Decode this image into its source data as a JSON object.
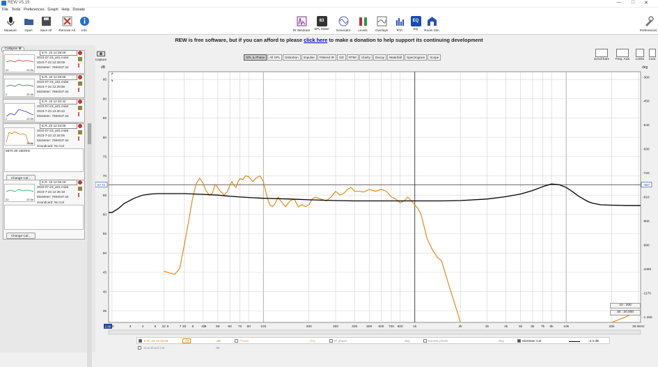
{
  "window": {
    "title": "REW V5.19",
    "minimize": "—",
    "maximize": "□",
    "close": "✕"
  },
  "menu": [
    "File",
    "Tools",
    "Preferences",
    "Graph",
    "Help",
    "Donate"
  ],
  "toolbar_left": [
    {
      "label": "Measure",
      "icon": "microphone-icon",
      "color": "#2a2a2a"
    },
    {
      "label": "Open",
      "icon": "folder-icon",
      "color": "#3a5d9a"
    },
    {
      "label": "Save All",
      "icon": "save-icon",
      "color": "#4a4a4a"
    },
    {
      "label": "Remove All",
      "icon": "remove-all-icon",
      "color": "#c0392b"
    },
    {
      "label": "Info",
      "icon": "info-icon",
      "color": "#1f6fd0"
    }
  ],
  "toolbar_center": [
    {
      "label": "IR Windows",
      "icon": "ir-windows-icon",
      "color": "#7a3a8a"
    },
    {
      "label": "SPL Meter",
      "icon": "spl-meter-icon",
      "color": "#333333",
      "text": "83"
    },
    {
      "label": "Generator",
      "icon": "generator-icon",
      "color": "#5060c0"
    },
    {
      "label": "Levels",
      "icon": "levels-icon",
      "color": "#c03030"
    },
    {
      "label": "Overlays",
      "icon": "overlays-icon",
      "color": "#6a6a6a"
    },
    {
      "label": "RTA",
      "icon": "rta-icon",
      "color": "#2a50b0"
    },
    {
      "label": "EQ",
      "icon": "eq-icon",
      "color": "#1a4ab0",
      "text": "EQ"
    },
    {
      "label": "Room Sim",
      "icon": "room-sim-icon",
      "color": "#2a50b0"
    }
  ],
  "toolbar_right": {
    "label": "Preferences",
    "icon": "preferences-icon"
  },
  "banner": {
    "before": "REW is free software, but if you can afford to please ",
    "link": "click here",
    "after": " to make a donation to help support its continuing development"
  },
  "left_panel": {
    "collapse_label": "Collapse",
    "measurements": [
      {
        "name": "E.R. 23 12:28:09",
        "file": "2023-07-23_a01.mdat",
        "date": "2023-7-23 12:28:09",
        "cal": "MicMeter: 7694037.txt",
        "thumb_color": "#c03030",
        "axis_left": "22",
        "axis_right": "20.0k"
      },
      {
        "name": "E.R. 23 12:29:56",
        "file": "2023-07-23_a01.mdat",
        "date": "2023-7-23 12:29:56",
        "cal": "MicMeter: 7694037.txt",
        "thumb_color": "#2a6a3a",
        "axis_left": "2",
        "axis_right": "20.0k"
      },
      {
        "name": "E.R. 23 12:30:42",
        "file": "2023-07-23_a01.mdat",
        "date": "2023-7-23 12:30:42",
        "cal": "MicMeter: 7694037.txt",
        "thumb_color": "#2a40c0",
        "axis_left": "2",
        "axis_right": "20.0k"
      },
      {
        "name": "E.R. 23 12:34:06",
        "file": "2023-07-23_a01.mdat",
        "date": "2023-7-23 12:34:06",
        "cal": "MicMeter: 7694037.txt",
        "extra": "Soundcard: No Cal",
        "thumb_color": "#e07a10",
        "axis_left": "",
        "axis_right": "20.0k"
      },
      {
        "name": "E.R. 23 12:36:18",
        "file": "2023-07-23_a01.mdat",
        "date": "2023-7-23 12:36:18",
        "cal": "MicMeter: 7694037.txt",
        "extra": "Soundcard: No Cal",
        "thumb_color": "#1a9a3a",
        "axis_left": "22",
        "axis_right": "20.0k"
      }
    ],
    "notes_text": "6870 30-1600Hz",
    "change_cal": "Change Cal..."
  },
  "graph_tabs": [
    "SPL & Phase",
    "All SPL",
    "Distortion",
    "Impulse",
    "Filtered IR",
    "GD",
    "RT60",
    "Clarity",
    "Decay",
    "Waterfall",
    "Spectrogram",
    "Scope"
  ],
  "active_tab": "SPL & Phase",
  "left_tools": {
    "capture": "Capture",
    "unit": "dB"
  },
  "right_tools": [
    {
      "label": "Scroll bars",
      "icon": "scroll-bars-icon"
    },
    {
      "label": "Freq. Axis",
      "icon": "freq-axis-icon"
    },
    {
      "label": "Limits",
      "icon": "limits-icon"
    },
    {
      "label": "Cont",
      "icon": "controls-icon"
    }
  ],
  "right_unit": "deg",
  "chart_data": {
    "type": "line",
    "xscale": "log",
    "xlim": [
      9.5,
      31000
    ],
    "ylim": [
      32,
      97
    ],
    "y2lim": [
      -1280,
      -340
    ],
    "grid": true,
    "x_ticks": [
      {
        "v": 10,
        "label": "10"
      },
      {
        "v": 22,
        "label": "22"
      },
      {
        "v": 30,
        "label": "30"
      },
      {
        "v": 40,
        "label": "40"
      },
      {
        "v": 50,
        "label": "50"
      },
      {
        "v": 60,
        "label": "60"
      },
      {
        "v": 70,
        "label": "70"
      },
      {
        "v": 80,
        "label": "80"
      },
      {
        "v": 100,
        "label": "100"
      },
      {
        "v": 200,
        "label": "200"
      },
      {
        "v": 300,
        "label": "300"
      },
      {
        "v": 400,
        "label": "400"
      },
      {
        "v": 500,
        "label": "500"
      },
      {
        "v": 600,
        "label": "600"
      },
      {
        "v": 700,
        "label": "700"
      },
      {
        "v": 800,
        "label": "800"
      },
      {
        "v": 1000,
        "label": "1k"
      },
      {
        "v": 2000,
        "label": "2k"
      },
      {
        "v": 3000,
        "label": "3k"
      },
      {
        "v": 4000,
        "label": "4k"
      },
      {
        "v": 5000,
        "label": "5k"
      },
      {
        "v": 6000,
        "label": "6k"
      },
      {
        "v": 7000,
        "label": "7k"
      },
      {
        "v": 8000,
        "label": "8k"
      },
      {
        "v": 10000,
        "label": "10k"
      },
      {
        "v": 20000,
        "label": "20k"
      },
      {
        "v": 30000,
        "label": "30.0kHz"
      }
    ],
    "x_ticks_left": [
      {
        "v": 3,
        "label": "3"
      },
      {
        "v": 4,
        "label": "4"
      },
      {
        "v": 5,
        "label": "5"
      },
      {
        "v": 6,
        "label": "6"
      },
      {
        "v": 7,
        "label": "7"
      },
      {
        "v": 8,
        "label": "8"
      },
      {
        "v": 9,
        "label": "9"
      }
    ],
    "x_start_label": "2.00",
    "y_ticks": [
      95,
      90,
      85,
      80,
      75,
      70,
      65,
      60,
      55,
      50,
      45,
      40,
      35
    ],
    "y2_ticks": [
      {
        "v": -360,
        "label": "-360"
      },
      {
        "v": -450,
        "label": "-450"
      },
      {
        "v": -540,
        "label": "-540"
      },
      {
        "v": -630,
        "label": "-630"
      },
      {
        "v": -720,
        "label": "-720"
      },
      {
        "v": -810,
        "label": "-810"
      },
      {
        "v": -900,
        "label": "-900"
      },
      {
        "v": -990,
        "label": "-990"
      },
      {
        "v": -1080,
        "label": "-1080"
      },
      {
        "v": -1170,
        "label": "-1170"
      },
      {
        "v": -1260,
        "label": "-1 260"
      }
    ],
    "y_cursor": {
      "value": 67.7,
      "label": "67.72"
    },
    "y2_cursor_label": "-567",
    "x_cursor": 1000,
    "series": [
      {
        "name": "E.R. 23 12:34:06",
        "color": "#e08a1a",
        "x": [
          22,
          24,
          26,
          28,
          30,
          32,
          34,
          36,
          38,
          40,
          42,
          44,
          46,
          48,
          50,
          52,
          55,
          58,
          60,
          62,
          64,
          66,
          68,
          70,
          73,
          76,
          80,
          85,
          90,
          95,
          100,
          105,
          110,
          115,
          120,
          125,
          130,
          140,
          150,
          160,
          170,
          180,
          190,
          200,
          210,
          220,
          240,
          260,
          280,
          300,
          320,
          340,
          360,
          380,
          400,
          430,
          460,
          500,
          550,
          600,
          650,
          700,
          750,
          800,
          850,
          900,
          950,
          1000,
          1050,
          1100,
          1150,
          1200,
          1300,
          1400,
          1500,
          1700,
          1900,
          2000,
          2200,
          2400,
          2600,
          3000,
          3500,
          4000,
          5000,
          6000,
          7000,
          8000,
          10000,
          12000,
          15000,
          20000,
          25000,
          30000
        ],
        "values": [
          45.3,
          44.8,
          44.5,
          46.0,
          52.0,
          58.0,
          64.0,
          68.0,
          69.4,
          68.0,
          66.0,
          65.0,
          65.5,
          67.8,
          67.0,
          66.0,
          65.0,
          66.0,
          67.5,
          68.5,
          67.5,
          67.0,
          68.5,
          69.3,
          69.0,
          70.0,
          69.8,
          68.5,
          69.5,
          70.0,
          68.5,
          65.0,
          62.5,
          62.0,
          63.0,
          64.5,
          63.5,
          62.0,
          63.5,
          64.0,
          62.0,
          62.5,
          62.0,
          62.5,
          64.0,
          64.5,
          64.0,
          63.5,
          64.5,
          66.0,
          65.0,
          65.5,
          66.5,
          67.0,
          66.0,
          66.0,
          65.8,
          66.5,
          66.0,
          66.5,
          66.0,
          64.5,
          64.0,
          63.0,
          63.5,
          64.5,
          63.5,
          62.5,
          61.5,
          60.0,
          57.0,
          54.0,
          51.0,
          49.0,
          48.0,
          41.0,
          35.0,
          32.0,
          28.0,
          25.0,
          22.0,
          19.0,
          19.0,
          19.0,
          21.0,
          22.0,
          24.0,
          25.0,
          27.0,
          29.0,
          30.0,
          32.0,
          33.5,
          35.0
        ]
      },
      {
        "name": "MicMeter Cal",
        "color": "#000000",
        "x": [
          9.5,
          10,
          11,
          12,
          14,
          16,
          18,
          20,
          22,
          25,
          30,
          35,
          40,
          50,
          60,
          80,
          100,
          150,
          200,
          300,
          400,
          500,
          700,
          1000,
          1500,
          2000,
          3000,
          4000,
          5000,
          6000,
          7000,
          8000,
          9000,
          10000,
          11000,
          12000,
          13000,
          14000,
          15000,
          17000,
          20000,
          25000,
          31000
        ],
        "values": [
          60.5,
          60.5,
          61.5,
          62.8,
          64.2,
          65.0,
          65.3,
          65.4,
          65.4,
          65.4,
          65.4,
          65.3,
          65.2,
          65.0,
          64.7,
          64.4,
          64.2,
          64.0,
          63.8,
          63.6,
          63.5,
          63.5,
          63.5,
          63.5,
          63.5,
          63.6,
          64.0,
          64.6,
          65.3,
          66.2,
          67.2,
          67.9,
          67.7,
          67.0,
          65.9,
          64.8,
          64.0,
          63.3,
          62.9,
          62.5,
          62.4,
          62.3,
          62.3
        ]
      }
    ]
  },
  "right_range": {
    "top": "10 : 200",
    "bottom": "30 : 20,000"
  },
  "legend": {
    "row1": {
      "meas_label": "E.R. 23 12:34:06",
      "smoothing": "1/6",
      "unit_spl": "dB",
      "phase": "Phase",
      "deg1": "deg",
      "ir_phase": "IR phase",
      "deg2": "deg",
      "excess": "Excess phase",
      "deg3": "deg",
      "cal": "MicMeter Cal",
      "cal_value": "-3.3 dB"
    },
    "row2": {
      "soundcard": "Soundcard Cal",
      "unit": "dB"
    }
  },
  "colors": {
    "accent_orange": "#e08a1a",
    "cursor_blue": "#1f3fa0"
  }
}
